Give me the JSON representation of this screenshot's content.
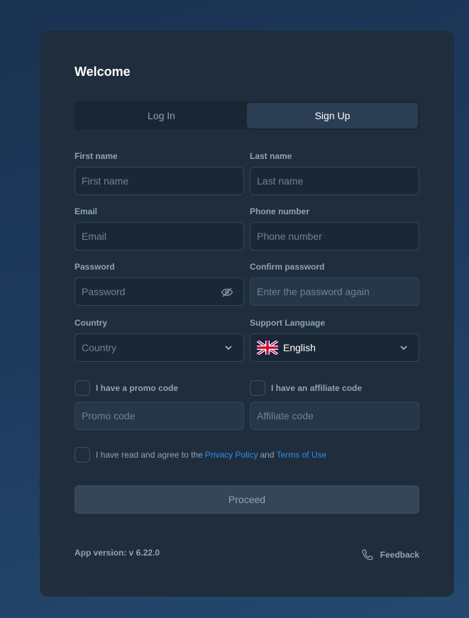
{
  "header": {
    "title": "Welcome"
  },
  "tabs": [
    {
      "label": "Log In",
      "active": false
    },
    {
      "label": "Sign Up",
      "active": true
    }
  ],
  "fields": {
    "first_name": {
      "label": "First name",
      "placeholder": "First name"
    },
    "last_name": {
      "label": "Last name",
      "placeholder": "Last name"
    },
    "email": {
      "label": "Email",
      "placeholder": "Email"
    },
    "phone": {
      "label": "Phone number",
      "placeholder": "Phone number"
    },
    "password": {
      "label": "Password",
      "placeholder": "Password"
    },
    "confirm_password": {
      "label": "Confirm password",
      "placeholder": "Enter the password again"
    },
    "country": {
      "label": "Country",
      "placeholder": "Country"
    },
    "language": {
      "label": "Support Language",
      "value": "English",
      "flag_icon": "uk-flag-icon"
    }
  },
  "promo": {
    "checkbox_label": "I have a promo code",
    "placeholder": "Promo code",
    "checked": false
  },
  "affiliate": {
    "checkbox_label": "I have an affiliate code",
    "placeholder": "Affiliate code",
    "checked": false
  },
  "agreement": {
    "prefix": "I have read and agree to the",
    "privacy_link": "Privacy Policy",
    "conjunction": "and",
    "terms_link": "Terms of Use",
    "checked": false
  },
  "actions": {
    "proceed_label": "Proceed"
  },
  "footer": {
    "version": "App version: v 6.22.0",
    "feedback_label": "Feedback",
    "feedback_icon": "phone-icon"
  },
  "colors": {
    "background": "#1d3a5d",
    "card": "#1f2d3c",
    "link": "#2e8ff0",
    "muted_text": "#8ea3bb"
  }
}
